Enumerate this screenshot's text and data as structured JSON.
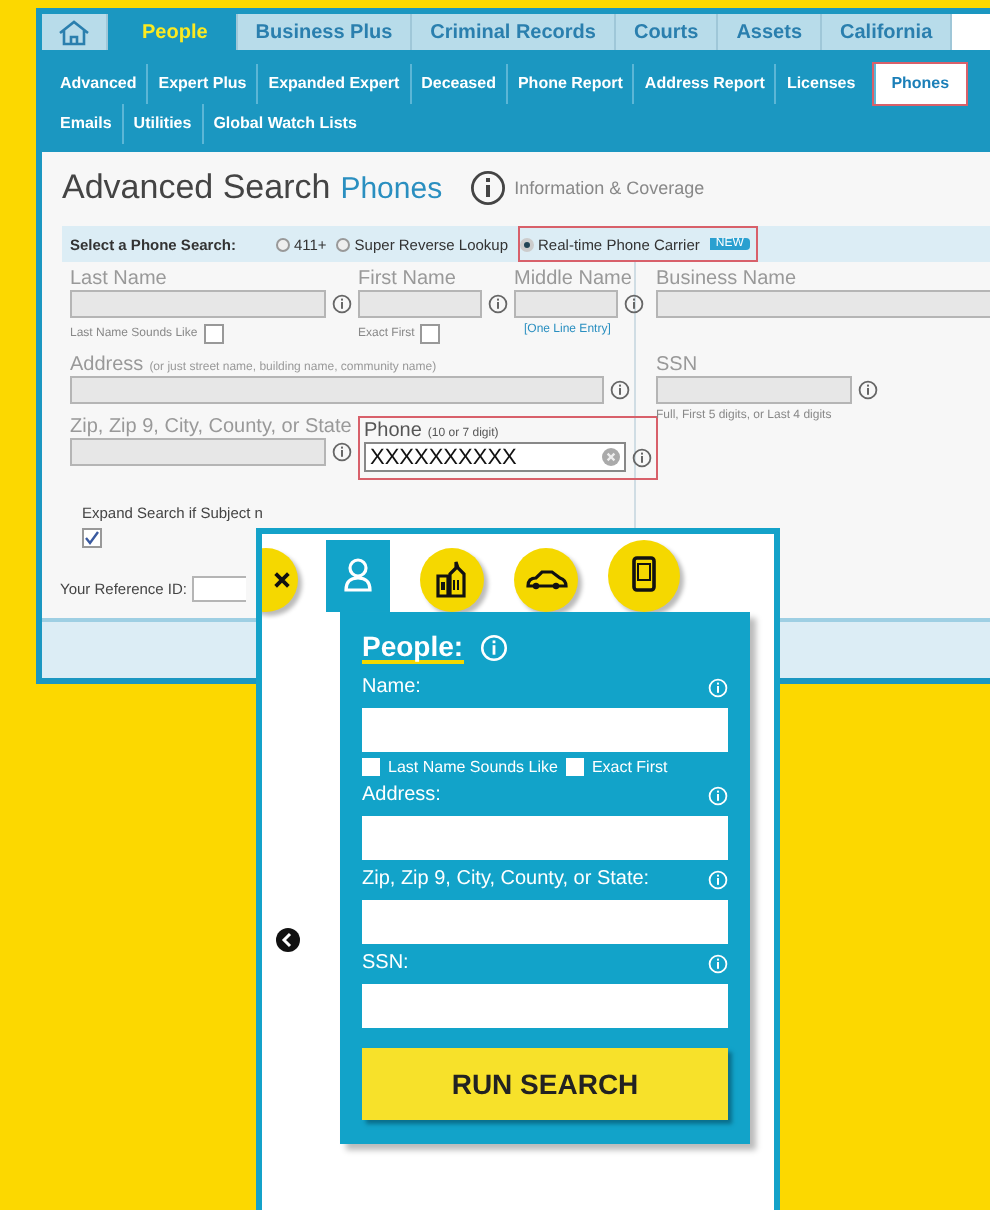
{
  "top_tabs": [
    {
      "kind": "home",
      "selected": false
    },
    {
      "kind": "text",
      "label": "People",
      "selected": true
    },
    {
      "kind": "text",
      "label": "Business Plus",
      "selected": false
    },
    {
      "kind": "text",
      "label": "Criminal Records",
      "selected": false
    },
    {
      "kind": "text",
      "label": "Courts",
      "selected": false
    },
    {
      "kind": "text",
      "label": "Assets",
      "selected": false
    },
    {
      "kind": "text",
      "label": "California",
      "selected": false
    }
  ],
  "sub_nav_rows": [
    [
      {
        "label": "Advanced",
        "selected": false
      },
      {
        "label": "Expert Plus",
        "selected": false
      },
      {
        "label": "Expanded Expert",
        "selected": false
      },
      {
        "label": "Deceased",
        "selected": false
      },
      {
        "label": "Phone Report",
        "selected": false
      },
      {
        "label": "Address Report",
        "selected": false
      },
      {
        "label": "Licenses",
        "selected": false
      },
      {
        "label": "Phones",
        "selected": true,
        "highlighted": true
      }
    ],
    [
      {
        "label": "Emails",
        "selected": false
      },
      {
        "label": "Utilities",
        "selected": false
      },
      {
        "label": "Global Watch Lists",
        "selected": false
      }
    ]
  ],
  "page_title": "Advanced Search",
  "page_section": "Phones",
  "info_link": "Information & Coverage",
  "phone_search": {
    "label": "Select a Phone Search:",
    "options": [
      {
        "label": "411+",
        "selected": false
      },
      {
        "label": "Super Reverse Lookup",
        "selected": false
      },
      {
        "label": "Real-time Phone Carrier",
        "selected": true,
        "highlighted": true,
        "badge": "NEW"
      }
    ]
  },
  "form": {
    "last_name": "Last Name",
    "first_name": "First Name",
    "middle_name": "Middle Name",
    "last_name_option": {
      "label": "Last Name Sounds Like",
      "checked": false
    },
    "first_name_option": {
      "label": "Exact First",
      "checked": false
    },
    "one_line_link": "[One Line Entry]",
    "address": "Address",
    "address_hint": "(or just street name, building name, community name)",
    "zip": "Zip, Zip 9, City, County, or State",
    "phone": {
      "label": "Phone",
      "hint": "(10 or 7 digit)",
      "value": "XXXXXXXXXX",
      "highlighted": true
    },
    "business_name": "Business Name",
    "ssn": "SSN",
    "ssn_hint": "Full, First 5 digits, or Last 4 digits",
    "expand": {
      "label": "Expand Search if Subject n",
      "checked": true
    },
    "reference": "Your Reference ID:"
  },
  "mobile": {
    "tabs": [
      {
        "kind": "close",
        "selected": false
      },
      {
        "kind": "person",
        "selected": true
      },
      {
        "kind": "buildings",
        "selected": false
      },
      {
        "kind": "car",
        "selected": false
      },
      {
        "kind": "phone",
        "selected": false
      }
    ],
    "title": "People:",
    "fields": [
      {
        "label": "Name:",
        "options": [
          {
            "label": "Last Name Sounds Like",
            "checked": false
          },
          {
            "label": "Exact First",
            "checked": false
          }
        ]
      },
      {
        "label": "Address:"
      },
      {
        "label": "Zip, Zip 9, City, County, or State:"
      },
      {
        "label": "SSN:"
      }
    ],
    "button": "RUN SEARCH"
  }
}
